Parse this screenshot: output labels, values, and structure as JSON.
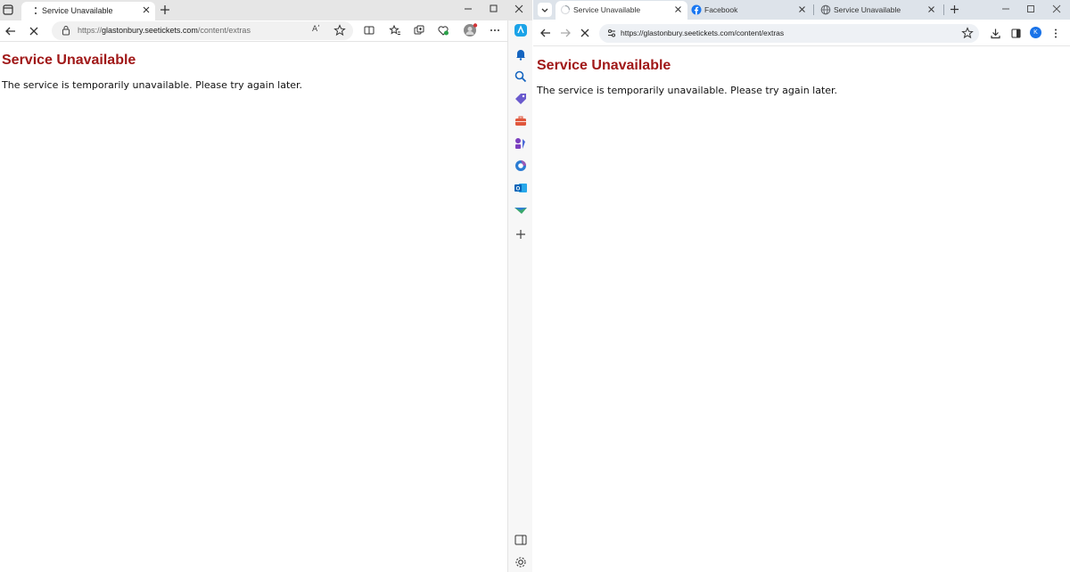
{
  "edge": {
    "tab": {
      "title": "Service Unavailable"
    },
    "address": {
      "url_prefix": "https://",
      "url_host": "glastonbury.seetickets.com",
      "url_path": "/content/extras",
      "read_aloud": "Aʹ"
    },
    "page": {
      "heading": "Service Unavailable",
      "message": "The service is temporarily unavailable. Please try again later."
    }
  },
  "chrome": {
    "tabs": [
      {
        "title": "Service Unavailable",
        "active": true
      },
      {
        "title": "Facebook",
        "active": false
      },
      {
        "title": "Service Unavailable",
        "active": false
      }
    ],
    "address": {
      "url": "https://glastonbury.seetickets.com/content/extras"
    },
    "profile_initial": "K",
    "page": {
      "heading": "Service Unavailable",
      "message": "The service is temporarily unavailable. Please try again later."
    }
  },
  "colors": {
    "heading_red": "#a01818",
    "edge_accent": "#0078d4",
    "chrome_profile": "#1a73e8",
    "facebook_blue": "#1877f2"
  }
}
